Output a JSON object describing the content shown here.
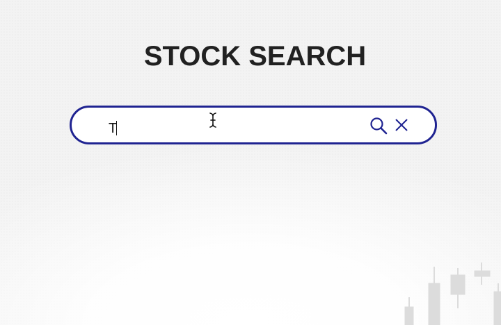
{
  "page": {
    "title": "STOCK SEARCH"
  },
  "search": {
    "value": "T",
    "placeholder": "",
    "search_icon": "search-icon",
    "clear_icon": "close-icon"
  },
  "colors": {
    "accent": "#1f2391",
    "title": "#212121",
    "background": "#f3f3f3"
  }
}
